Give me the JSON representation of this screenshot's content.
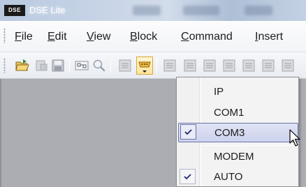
{
  "window": {
    "app_logo_text": "DSE",
    "title": "DSE Lite"
  },
  "menubar": {
    "items": [
      {
        "pre": "",
        "ul": "F",
        "post": "ile"
      },
      {
        "pre": "",
        "ul": "E",
        "post": "dit"
      },
      {
        "pre": "",
        "ul": "V",
        "post": "iew"
      },
      {
        "pre": "",
        "ul": "B",
        "post": "lock"
      },
      {
        "pre": "",
        "ul": "C",
        "post": "ommand"
      },
      {
        "pre": "",
        "ul": "I",
        "post": "nsert"
      }
    ]
  },
  "toolbar": {
    "buttons": [
      "open-folder-icon",
      "disabled-page-icon",
      "save-icon",
      "block-wiring-icon",
      "zoom-icon",
      "disabled-list-icon",
      "serial-port-icon",
      "disabled-list-icon",
      "disabled-list-icon",
      "disabled-list-icon",
      "disabled-list-icon"
    ],
    "active_button": "serial-port-icon"
  },
  "connection_menu": {
    "items": [
      {
        "label": "IP",
        "checked": false,
        "hover": false
      },
      {
        "label": "COM1",
        "checked": false,
        "hover": false
      },
      {
        "label": "COM3",
        "checked": true,
        "hover": true
      },
      {
        "label": "MODEM",
        "checked": false,
        "hover": false
      },
      {
        "label": "AUTO",
        "checked": true,
        "hover": false
      }
    ]
  },
  "colors": {
    "workspace": "#abadb3",
    "highlight_border": "#6c73a7",
    "check_color": "#1f2a6b"
  }
}
